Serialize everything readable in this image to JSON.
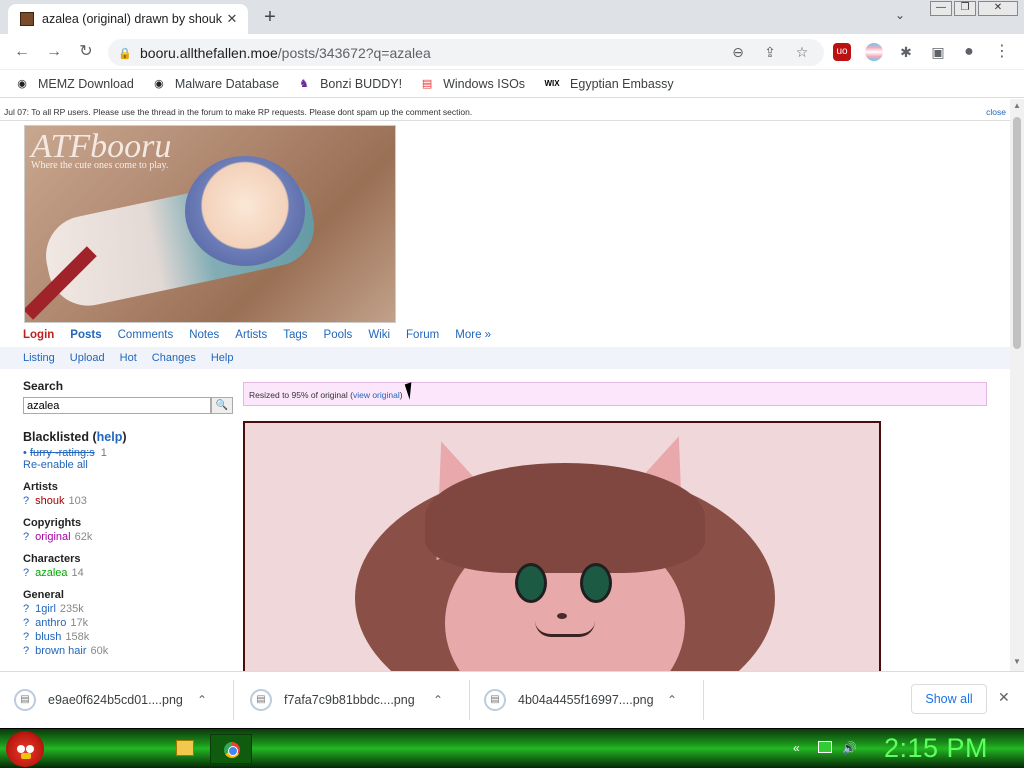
{
  "tab": {
    "title": "azalea (original) drawn by shouk",
    "close": "✕",
    "new_tab": "+"
  },
  "tab_search": "⌄",
  "window": {
    "min": "—",
    "max": "❐",
    "close": "✕"
  },
  "toolbar": {
    "back": "←",
    "forward": "→",
    "reload": "↻",
    "url_host": "booru.allthefallen.moe",
    "url_path": "/posts/343672?q=azalea",
    "zoom_icon": "⊖",
    "share_icon": "⇪",
    "star_icon": "☆",
    "ext_ublock": "uo",
    "ext_puzzle": "✱",
    "sidebar_icon": "▣",
    "profile_icon": "●",
    "menu_icon": "⋮"
  },
  "bookmarks": [
    {
      "label": "MEMZ Download",
      "icon": "github-icon",
      "glyph": "◉",
      "color": "#222"
    },
    {
      "label": "Malware Database",
      "icon": "github-icon",
      "glyph": "◉",
      "color": "#222"
    },
    {
      "label": "Bonzi BUDDY!",
      "icon": "bonzi-icon",
      "glyph": "♞",
      "color": "#6a2a9a"
    },
    {
      "label": "Windows ISOs",
      "icon": "rainbow-flag-icon",
      "glyph": "▤",
      "color": "#e33"
    },
    {
      "label": "Egyptian Embassy",
      "icon": "wix-icon",
      "glyph": "WIX",
      "color": "#000"
    }
  ],
  "notice": {
    "text": "Jul 07: To all RP users. Please use the thread in the forum to make RP requests. Please dont spam up the comment section.",
    "close": "close"
  },
  "banner": {
    "title": "ATFbooru",
    "subtitle": "Where the cute ones come to play."
  },
  "nav_primary": [
    "Login",
    "Posts",
    "Comments",
    "Notes",
    "Artists",
    "Tags",
    "Pools",
    "Wiki",
    "Forum",
    "More »"
  ],
  "nav_secondary": [
    "Listing",
    "Upload",
    "Hot",
    "Changes",
    "Help"
  ],
  "sidebar": {
    "search_heading": "Search",
    "search_value": "azalea",
    "blacklist_heading": "Blacklisted",
    "blacklist_help": "help",
    "blacklist_item": "furry -rating:s",
    "blacklist_count": "1",
    "reenable": "Re-enable all",
    "artists_heading": "Artists",
    "artists": [
      {
        "name": "shouk",
        "count": "103"
      }
    ],
    "copyrights_heading": "Copyrights",
    "copyrights": [
      {
        "name": "original",
        "count": "62k"
      }
    ],
    "characters_heading": "Characters",
    "characters": [
      {
        "name": "azalea",
        "count": "14"
      }
    ],
    "general_heading": "General",
    "general": [
      {
        "name": "1girl",
        "count": "235k"
      },
      {
        "name": "anthro",
        "count": "17k"
      },
      {
        "name": "blush",
        "count": "158k"
      },
      {
        "name": "brown hair",
        "count": "60k"
      }
    ]
  },
  "resize_notice": {
    "text": "Resized to 95% of original (",
    "link": "view original"
  },
  "downloads": [
    {
      "name": "e9ae0f624b5cd01....png"
    },
    {
      "name": "f7afa7c9b81bbdc....png"
    },
    {
      "name": "4b04a4455f16997....png"
    }
  ],
  "downloads_show_all": "Show all",
  "downloads_close": "✕",
  "taskbar": {
    "clock": "2:15 PM"
  },
  "colors": {
    "accent_link": "#2266bb",
    "taskbar_green": "#23b723",
    "clock_green": "#5dff5d"
  }
}
